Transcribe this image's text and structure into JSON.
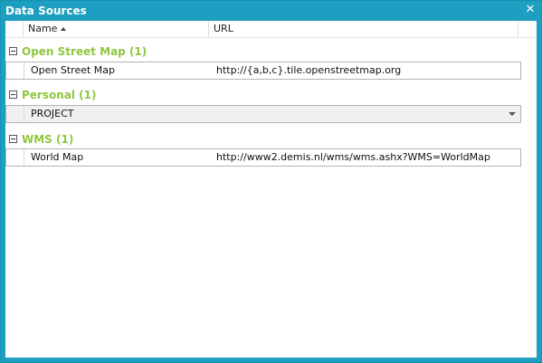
{
  "window": {
    "title": "Data Sources",
    "close_glyph": "✕"
  },
  "columns": {
    "name": "Name",
    "url": "URL"
  },
  "groups": [
    {
      "label": "Open Street Map (1)",
      "rows": [
        {
          "name": "Open Street Map",
          "url": "http://{a,b,c}.tile.openstreetmap.org"
        }
      ]
    },
    {
      "label": "Personal (1)",
      "rows": [
        {
          "name": "PROJECT",
          "url": ""
        }
      ]
    },
    {
      "label": "WMS (1)",
      "rows": [
        {
          "name": "World Map",
          "url": "http://www2.demis.nl/wms/wms.ashx?WMS=WorldMap"
        }
      ]
    }
  ],
  "colors": {
    "title_bar": "#1c9fc0",
    "group_label": "#8ec63f"
  },
  "icons": {
    "close": "close-icon",
    "sort": "sort-ascending-icon",
    "collapse": "collapse-minus-icon",
    "dropdown": "chevron-down-icon"
  }
}
